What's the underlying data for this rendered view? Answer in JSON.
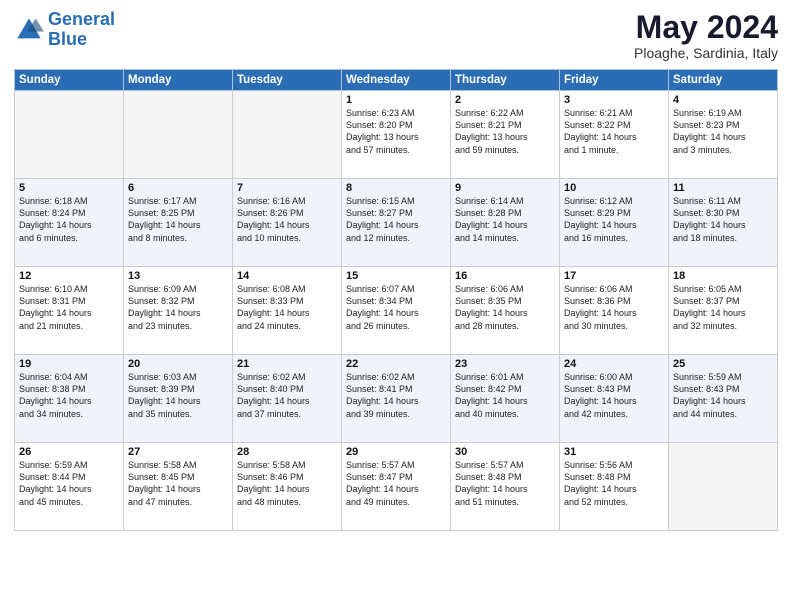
{
  "header": {
    "logo_line1": "General",
    "logo_line2": "Blue",
    "month_title": "May 2024",
    "subtitle": "Ploaghe, Sardinia, Italy"
  },
  "weekdays": [
    "Sunday",
    "Monday",
    "Tuesday",
    "Wednesday",
    "Thursday",
    "Friday",
    "Saturday"
  ],
  "weeks": [
    [
      {
        "day": "",
        "text": ""
      },
      {
        "day": "",
        "text": ""
      },
      {
        "day": "",
        "text": ""
      },
      {
        "day": "1",
        "text": "Sunrise: 6:23 AM\nSunset: 8:20 PM\nDaylight: 13 hours\nand 57 minutes."
      },
      {
        "day": "2",
        "text": "Sunrise: 6:22 AM\nSunset: 8:21 PM\nDaylight: 13 hours\nand 59 minutes."
      },
      {
        "day": "3",
        "text": "Sunrise: 6:21 AM\nSunset: 8:22 PM\nDaylight: 14 hours\nand 1 minute."
      },
      {
        "day": "4",
        "text": "Sunrise: 6:19 AM\nSunset: 8:23 PM\nDaylight: 14 hours\nand 3 minutes."
      }
    ],
    [
      {
        "day": "5",
        "text": "Sunrise: 6:18 AM\nSunset: 8:24 PM\nDaylight: 14 hours\nand 6 minutes."
      },
      {
        "day": "6",
        "text": "Sunrise: 6:17 AM\nSunset: 8:25 PM\nDaylight: 14 hours\nand 8 minutes."
      },
      {
        "day": "7",
        "text": "Sunrise: 6:16 AM\nSunset: 8:26 PM\nDaylight: 14 hours\nand 10 minutes."
      },
      {
        "day": "8",
        "text": "Sunrise: 6:15 AM\nSunset: 8:27 PM\nDaylight: 14 hours\nand 12 minutes."
      },
      {
        "day": "9",
        "text": "Sunrise: 6:14 AM\nSunset: 8:28 PM\nDaylight: 14 hours\nand 14 minutes."
      },
      {
        "day": "10",
        "text": "Sunrise: 6:12 AM\nSunset: 8:29 PM\nDaylight: 14 hours\nand 16 minutes."
      },
      {
        "day": "11",
        "text": "Sunrise: 6:11 AM\nSunset: 8:30 PM\nDaylight: 14 hours\nand 18 minutes."
      }
    ],
    [
      {
        "day": "12",
        "text": "Sunrise: 6:10 AM\nSunset: 8:31 PM\nDaylight: 14 hours\nand 21 minutes."
      },
      {
        "day": "13",
        "text": "Sunrise: 6:09 AM\nSunset: 8:32 PM\nDaylight: 14 hours\nand 23 minutes."
      },
      {
        "day": "14",
        "text": "Sunrise: 6:08 AM\nSunset: 8:33 PM\nDaylight: 14 hours\nand 24 minutes."
      },
      {
        "day": "15",
        "text": "Sunrise: 6:07 AM\nSunset: 8:34 PM\nDaylight: 14 hours\nand 26 minutes."
      },
      {
        "day": "16",
        "text": "Sunrise: 6:06 AM\nSunset: 8:35 PM\nDaylight: 14 hours\nand 28 minutes."
      },
      {
        "day": "17",
        "text": "Sunrise: 6:06 AM\nSunset: 8:36 PM\nDaylight: 14 hours\nand 30 minutes."
      },
      {
        "day": "18",
        "text": "Sunrise: 6:05 AM\nSunset: 8:37 PM\nDaylight: 14 hours\nand 32 minutes."
      }
    ],
    [
      {
        "day": "19",
        "text": "Sunrise: 6:04 AM\nSunset: 8:38 PM\nDaylight: 14 hours\nand 34 minutes."
      },
      {
        "day": "20",
        "text": "Sunrise: 6:03 AM\nSunset: 8:39 PM\nDaylight: 14 hours\nand 35 minutes."
      },
      {
        "day": "21",
        "text": "Sunrise: 6:02 AM\nSunset: 8:40 PM\nDaylight: 14 hours\nand 37 minutes."
      },
      {
        "day": "22",
        "text": "Sunrise: 6:02 AM\nSunset: 8:41 PM\nDaylight: 14 hours\nand 39 minutes."
      },
      {
        "day": "23",
        "text": "Sunrise: 6:01 AM\nSunset: 8:42 PM\nDaylight: 14 hours\nand 40 minutes."
      },
      {
        "day": "24",
        "text": "Sunrise: 6:00 AM\nSunset: 8:43 PM\nDaylight: 14 hours\nand 42 minutes."
      },
      {
        "day": "25",
        "text": "Sunrise: 5:59 AM\nSunset: 8:43 PM\nDaylight: 14 hours\nand 44 minutes."
      }
    ],
    [
      {
        "day": "26",
        "text": "Sunrise: 5:59 AM\nSunset: 8:44 PM\nDaylight: 14 hours\nand 45 minutes."
      },
      {
        "day": "27",
        "text": "Sunrise: 5:58 AM\nSunset: 8:45 PM\nDaylight: 14 hours\nand 47 minutes."
      },
      {
        "day": "28",
        "text": "Sunrise: 5:58 AM\nSunset: 8:46 PM\nDaylight: 14 hours\nand 48 minutes."
      },
      {
        "day": "29",
        "text": "Sunrise: 5:57 AM\nSunset: 8:47 PM\nDaylight: 14 hours\nand 49 minutes."
      },
      {
        "day": "30",
        "text": "Sunrise: 5:57 AM\nSunset: 8:48 PM\nDaylight: 14 hours\nand 51 minutes."
      },
      {
        "day": "31",
        "text": "Sunrise: 5:56 AM\nSunset: 8:48 PM\nDaylight: 14 hours\nand 52 minutes."
      },
      {
        "day": "",
        "text": ""
      }
    ]
  ]
}
